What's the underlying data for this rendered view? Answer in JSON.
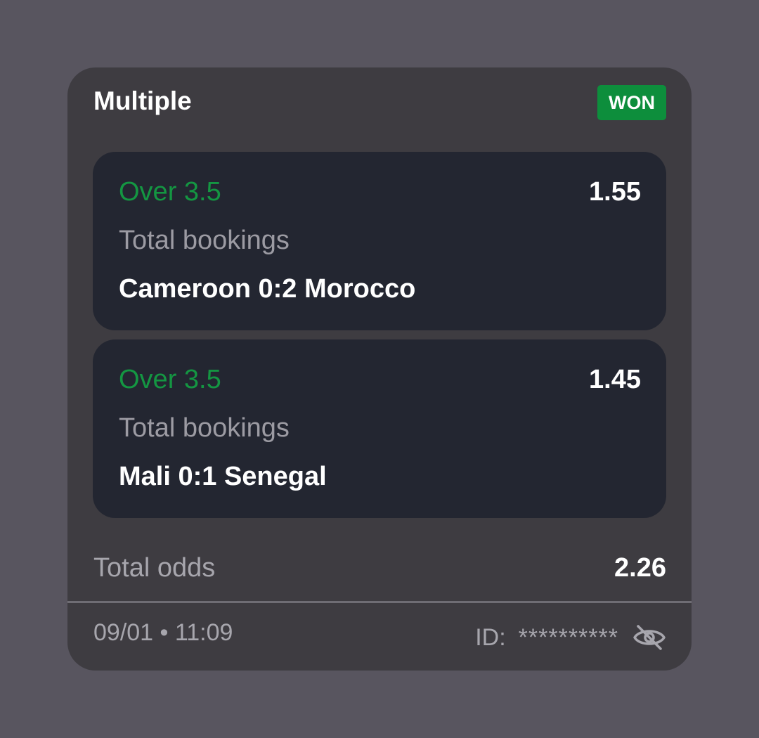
{
  "bet": {
    "title": "Multiple",
    "status": "WON",
    "status_color": "#0d8e3c",
    "selections": [
      {
        "market": "Over 3.5",
        "odds": "1.55",
        "type": "Total bookings",
        "match": "Cameroon 0:2 Morocco"
      },
      {
        "market": "Over 3.5",
        "odds": "1.45",
        "type": "Total bookings",
        "match": "Mali 0:1 Senegal"
      }
    ],
    "total_odds_label": "Total odds",
    "total_odds": "2.26",
    "date_time": "09/01 • 11:09",
    "id_label": "ID:",
    "id_value": "**********",
    "id_toggle_icon": "eye-off-icon"
  },
  "colors": {
    "background": "#58555f",
    "card": "#3e3c41",
    "selection_card": "#232631",
    "market_green": "#149642"
  }
}
